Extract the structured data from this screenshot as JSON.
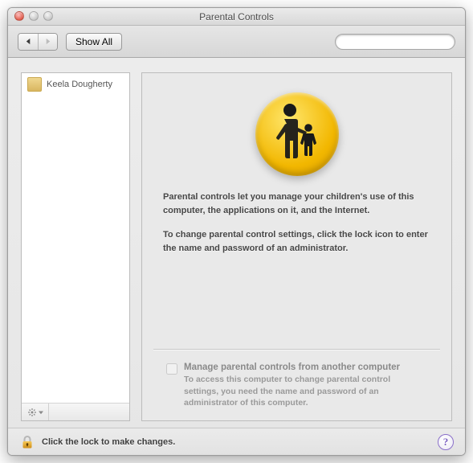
{
  "window": {
    "title": "Parental Controls"
  },
  "toolbar": {
    "show_all_label": "Show All",
    "search_placeholder": ""
  },
  "sidebar": {
    "users": [
      {
        "name": "Keela Dougherty"
      }
    ]
  },
  "main": {
    "intro_paragraph": "Parental controls let you manage your children's use of this computer, the applications on it, and the Internet.",
    "instruction_paragraph": "To change parental control settings, click the lock icon to enter the name and password of an administrator.",
    "remote_checkbox_label": "Manage parental controls from another computer",
    "remote_checkbox_desc": "To access this computer to change parental control settings, you need the name and password of an administrator of this computer.",
    "remote_checkbox_checked": false
  },
  "footer": {
    "lock_text": "Click the lock to make changes.",
    "help_symbol": "?"
  }
}
